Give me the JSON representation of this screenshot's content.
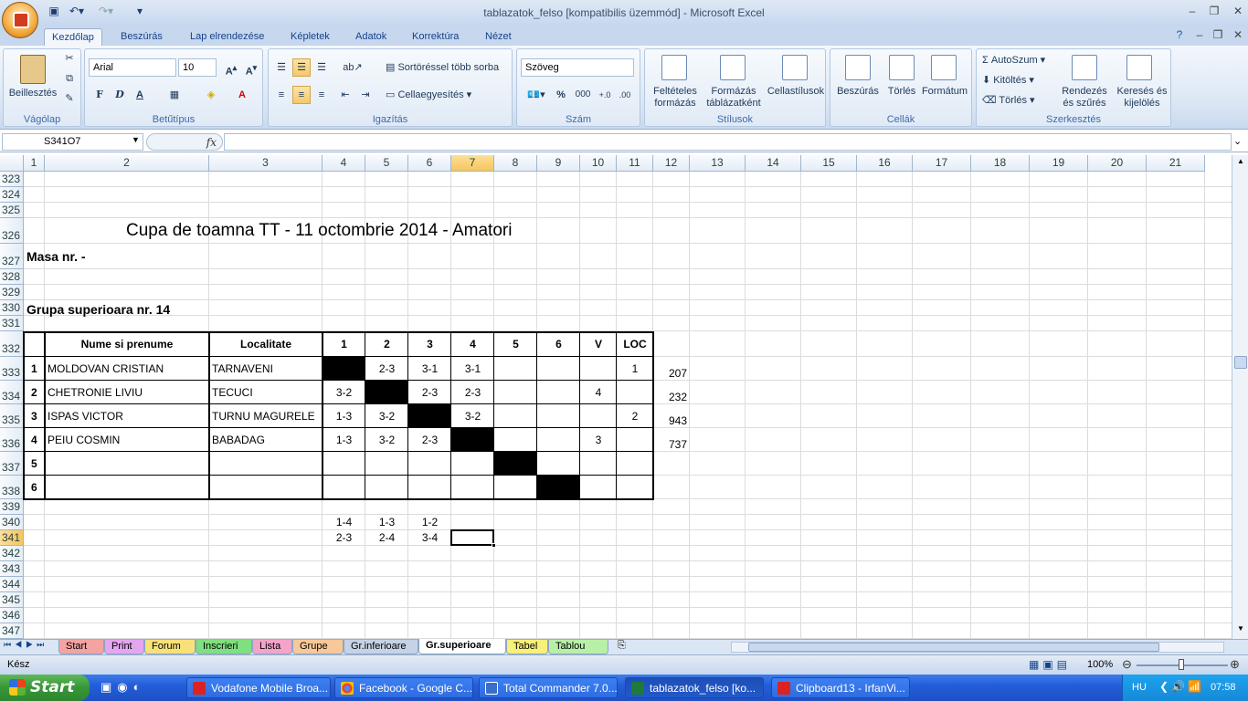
{
  "window": {
    "title": "tablazatok_felso  [kompatibilis üzemmód] - Microsoft Excel"
  },
  "ribbon": {
    "tabs": [
      "Kezdőlap",
      "Beszúrás",
      "Lap elrendezése",
      "Képletek",
      "Adatok",
      "Korrektúra",
      "Nézet"
    ],
    "active_tab": "Kezdőlap",
    "clipboard": {
      "paste": "Beillesztés",
      "group": "Vágólap"
    },
    "font": {
      "name": "Arial",
      "size": "10",
      "group": "Betűtípus",
      "bold": "F",
      "italic": "D",
      "underline": "A"
    },
    "alignment": {
      "wrap": "Sortöréssel több sorba",
      "merge": "Cellaegyesítés",
      "group": "Igazítás"
    },
    "number": {
      "format": "Szöveg",
      "percent": "%",
      "thousands": "000",
      "group": "Szám"
    },
    "styles": {
      "conditional": "Feltételes formázás",
      "format_table": "Formázás táblázatként",
      "cell_styles": "Cellastílusok",
      "group": "Stílusok"
    },
    "cells": {
      "insert": "Beszúrás",
      "delete": "Törlés",
      "format": "Formátum",
      "group": "Cellák"
    },
    "editing": {
      "autosum": "AutoSzum",
      "fill": "Kitöltés",
      "clear": "Törlés",
      "sort": "Rendezés és szűrés",
      "find": "Keresés és kijelölés",
      "group": "Szerkesztés"
    }
  },
  "formula_bar": {
    "name_box": "S341O7",
    "fx": "fx",
    "value": ""
  },
  "columns": [
    "1",
    "2",
    "3",
    "4",
    "5",
    "6",
    "7",
    "8",
    "9",
    "10",
    "11",
    "12",
    "13",
    "14",
    "15",
    "16",
    "17",
    "18",
    "19",
    "20",
    "21"
  ],
  "rows": [
    "323",
    "324",
    "325",
    "326",
    "327",
    "328",
    "329",
    "330",
    "331",
    "332",
    "333",
    "334",
    "335",
    "336",
    "337",
    "338",
    "339",
    "340",
    "341",
    "342",
    "343",
    "344",
    "345",
    "346",
    "347"
  ],
  "sheet": {
    "title": "Cupa de toamna TT - 11 octombrie 2014 - Amatori",
    "masa": "Masa nr.  -",
    "group": "Grupa superioara nr. 14",
    "headers": [
      "",
      "Nume si prenume",
      "Localitate",
      "1",
      "2",
      "3",
      "4",
      "5",
      "6",
      "V",
      "LOC"
    ],
    "players": [
      {
        "no": "1",
        "name": "MOLDOVAN CRISTIAN",
        "city": "TARNAVENI",
        "r": [
          "",
          "2-3",
          "3-1",
          "3-1",
          "",
          "",
          "",
          "1"
        ],
        "extra": "207"
      },
      {
        "no": "2",
        "name": "CHETRONIE LIVIU",
        "city": "TECUCI",
        "r": [
          "3-2",
          "",
          "2-3",
          "2-3",
          "",
          "",
          "4",
          ""
        ],
        "extra": "232"
      },
      {
        "no": "3",
        "name": "ISPAS VICTOR",
        "city": "TURNU MAGURELE",
        "r": [
          "1-3",
          "3-2",
          "",
          "3-2",
          "",
          "",
          "",
          "2"
        ],
        "extra": "943"
      },
      {
        "no": "4",
        "name": "PEIU COSMIN",
        "city": "BABADAG",
        "r": [
          "1-3",
          "3-2",
          "2-3",
          "",
          "",
          "",
          "3",
          ""
        ],
        "extra": "737"
      },
      {
        "no": "5",
        "name": "",
        "city": "",
        "r": [
          "",
          "",
          "",
          "",
          "",
          "",
          "",
          ""
        ],
        "extra": ""
      },
      {
        "no": "6",
        "name": "",
        "city": "",
        "r": [
          "",
          "",
          "",
          "",
          "",
          "",
          "",
          ""
        ],
        "extra": ""
      }
    ],
    "pairs_row1": [
      "1-4",
      "1-3",
      "1-2"
    ],
    "pairs_row2": [
      "2-3",
      "2-4",
      "3-4"
    ]
  },
  "sheet_tabs": [
    {
      "label": "Start",
      "color": "#f4a3a3"
    },
    {
      "label": "Print",
      "color": "#e3a6f0"
    },
    {
      "label": "Forum",
      "color": "#f7e17a"
    },
    {
      "label": "Inscrieri",
      "color": "#7fe07f"
    },
    {
      "label": "Lista",
      "color": "#f4a3c9"
    },
    {
      "label": "Grupe",
      "color": "#f7c89a"
    },
    {
      "label": "Gr.inferioare",
      "color": "#c5d3e6"
    },
    {
      "label": "Gr.superioare",
      "color": "#ffffff"
    },
    {
      "label": "Tabel",
      "color": "#f7f07a"
    },
    {
      "label": "Tablou",
      "color": "#b8f0a8"
    }
  ],
  "status": {
    "ready": "Kész",
    "zoom": "100%"
  },
  "taskbar": {
    "start": "Start",
    "items": [
      "Vodafone Mobile Broa...",
      "Facebook - Google C...",
      "Total Commander 7.0...",
      "tablazatok_felso  [ko...",
      "Clipboard13 - IrfanVi..."
    ],
    "lang": "HU",
    "time": "07:58"
  }
}
